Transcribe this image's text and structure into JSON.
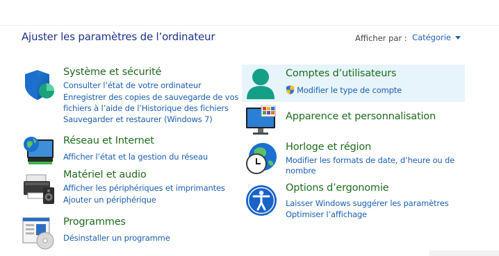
{
  "header": {
    "title": "Ajuster les paramètres de l’ordinateur",
    "view_by_label": "Afficher par :",
    "view_by_value": "Catégorie"
  },
  "left": [
    {
      "title": "Système et sécurité",
      "icon": "shield-icon",
      "links": [
        "Consulter l’état de votre ordinateur",
        "Enregistrer des copies de sauvegarde de vos",
        "fichiers à l’aide de l’Historique des fichiers",
        "Sauvegarder et restaurer (Windows 7)"
      ]
    },
    {
      "title": "Réseau et Internet",
      "icon": "network-globe-icon",
      "links": [
        "Afficher l’état et la gestion du réseau"
      ]
    },
    {
      "title": "Matériel et audio",
      "icon": "printer-speaker-icon",
      "links": [
        "Afficher les périphériques et imprimantes",
        "Ajouter un périphérique"
      ]
    },
    {
      "title": "Programmes",
      "icon": "programs-disc-icon",
      "links": [
        "Désinstaller un programme"
      ]
    }
  ],
  "right": [
    {
      "title": "Comptes d’utilisateurs",
      "icon": "user-accounts-icon",
      "links": [
        "Modifier le type de compte"
      ]
    },
    {
      "title": "Apparence et personnalisation",
      "icon": "monitor-palette-icon",
      "links": []
    },
    {
      "title": "Horloge et région",
      "icon": "clock-globe-icon",
      "links": [
        "Modifier les formats de date, d’heure ou de",
        "nombre"
      ]
    },
    {
      "title": "Options d’ergonomie",
      "icon": "accessibility-icon",
      "links": [
        "Laisser Windows suggérer les paramètres",
        "Optimiser l’affichage"
      ]
    }
  ],
  "colors": {
    "title_green": "#1e6b1e",
    "link_blue": "#1a5fb4",
    "header_blue": "#1e3287",
    "highlight": "#e8f4fc"
  }
}
